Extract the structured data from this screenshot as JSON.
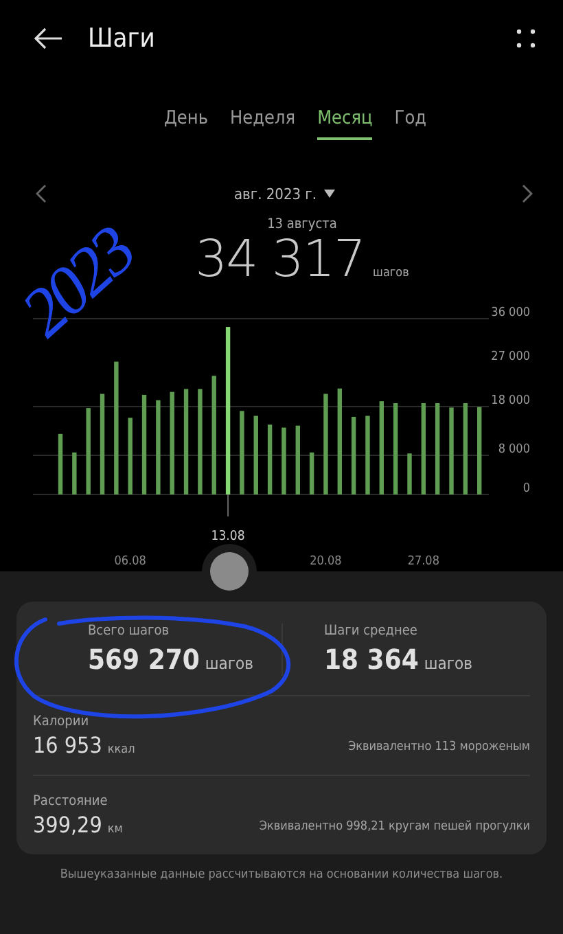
{
  "header": {
    "title": "Шаги"
  },
  "tabs": [
    {
      "label": "День",
      "selected": false
    },
    {
      "label": "Неделя",
      "selected": false
    },
    {
      "label": "Месяц",
      "selected": true
    },
    {
      "label": "Год",
      "selected": false
    }
  ],
  "period": {
    "label": "авг. 2023 г."
  },
  "selected_day": {
    "date": "13 августа",
    "steps": "34 317",
    "unit": "шагов"
  },
  "chart_data": {
    "type": "bar",
    "categories": [
      null,
      null,
      null,
      null,
      null,
      "06.08",
      null,
      null,
      null,
      null,
      null,
      null,
      null,
      null,
      null,
      null,
      null,
      null,
      null,
      "20.08",
      null,
      null,
      null,
      null,
      null,
      null,
      "27.08",
      null,
      null,
      null,
      null
    ],
    "series": [
      {
        "color": "#5f9e52",
        "values": [
          12400,
          8600,
          17700,
          20600,
          27200,
          15700,
          20400,
          19300,
          21000,
          21600,
          21600,
          24300,
          null,
          17100,
          16100,
          14300,
          13700,
          14100,
          8600,
          20600,
          21700,
          15900,
          16100,
          19100,
          18700,
          8400,
          18700,
          18700,
          17800,
          18700,
          17900
        ]
      },
      {
        "color": "#86d874",
        "values": [
          null,
          null,
          null,
          null,
          null,
          null,
          null,
          null,
          null,
          null,
          null,
          null,
          34300,
          null,
          null,
          null,
          null,
          null,
          null,
          null,
          null,
          null,
          null,
          null,
          null,
          null,
          null,
          null,
          null,
          null,
          null
        ]
      }
    ],
    "ylim": [
      0,
      36000
    ],
    "yticks": [
      {
        "value": 0,
        "label": "0"
      },
      {
        "value": 8000,
        "label": "8 000"
      },
      {
        "value": 18000,
        "label": "18 000"
      },
      {
        "value": 27000,
        "label": "27 000"
      },
      {
        "value": 36000,
        "label": "36 000"
      }
    ],
    "annotations": [
      {
        "text": "13.08"
      }
    ]
  },
  "summary": [
    {
      "label": "Всего шагов",
      "value": "569 270",
      "unit": "шагов"
    },
    {
      "label": "Шаги среднее",
      "value": "18 364",
      "unit": "шагов"
    }
  ],
  "metrics": [
    {
      "label": "Калории",
      "value": "16 953",
      "unit": "ккал",
      "note": "Эквивалентно 113 мороженым"
    },
    {
      "label": "Расстояние",
      "value": "399,29",
      "unit": "км",
      "note": "Эквивалентно 998,21 кругам пешей прогулки"
    }
  ],
  "footnote": "Вышеуказанные данные рассчитываются на основании количества шагов.",
  "handwriting": {
    "text": "2023",
    "circled": true
  }
}
